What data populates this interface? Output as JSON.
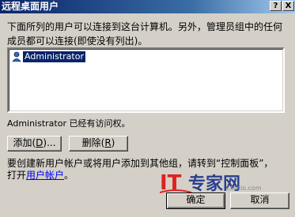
{
  "window": {
    "title": "远程桌面用户",
    "help_label": "?",
    "close_label": "X"
  },
  "description": {
    "line1": "下面所列的用户可以连接到这台计算机。另外，管理员组中的任何",
    "line2": "成员都可以连接(即使没有列出)。"
  },
  "users": [
    {
      "name": "Administrator"
    }
  ],
  "access_text": "Administrator 已经有访问权。",
  "buttons": {
    "add_prefix": "添加(",
    "add_key": "D",
    "add_suffix": ")...",
    "remove_prefix": "删除(",
    "remove_key": "R",
    "remove_suffix": ")",
    "ok": "确定",
    "cancel": "取消"
  },
  "hint": {
    "line1": "要创建新用户帐户或将用户添加到其他组，请转到“控制面板”，",
    "line2_prefix": "打开",
    "link": "用户帐户",
    "line2_suffix": "。"
  },
  "watermark": {
    "brand": "IT专家网",
    "site": "Ctocio.com"
  }
}
